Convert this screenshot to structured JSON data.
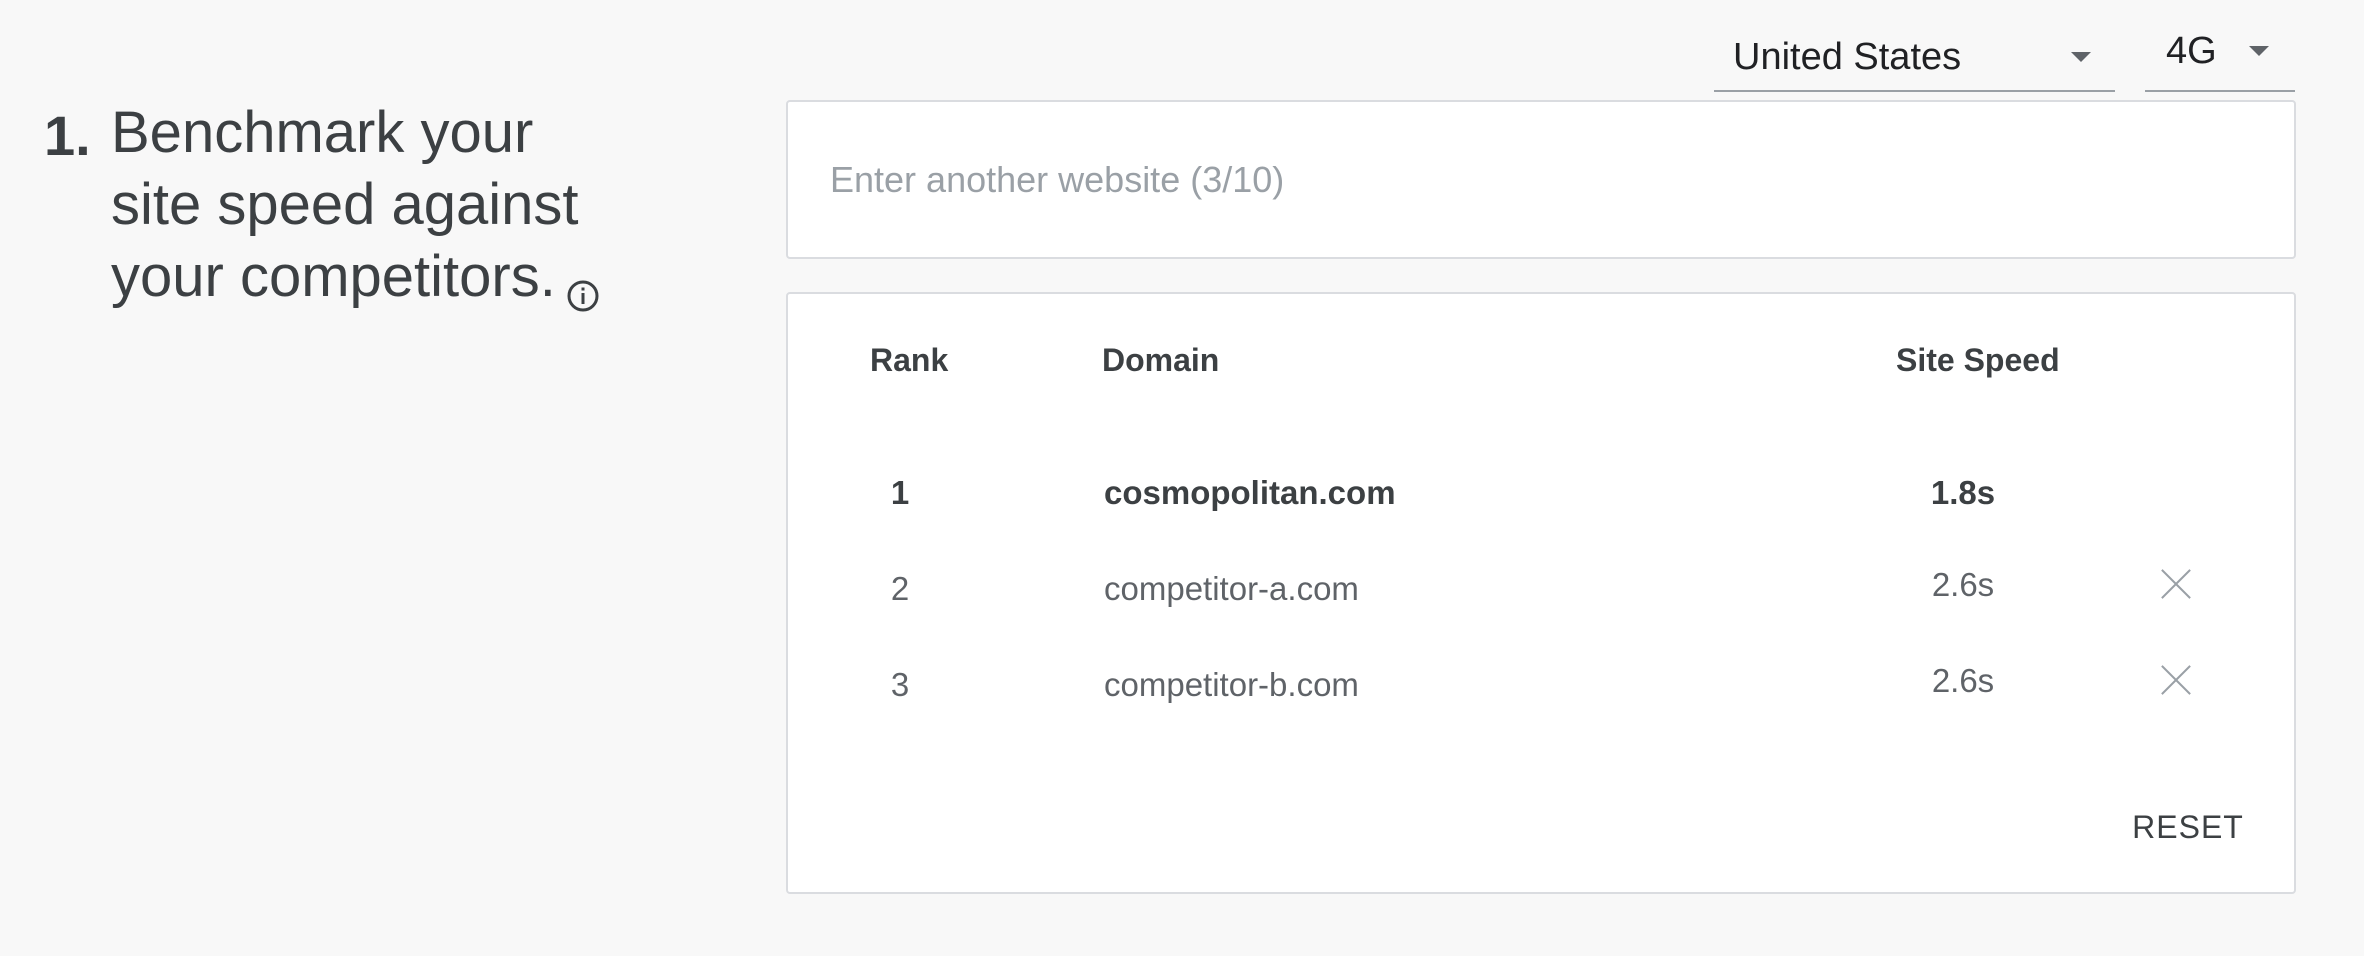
{
  "heading": {
    "number": "1.",
    "lines": [
      "Benchmark your",
      "site speed against",
      "your competitors."
    ],
    "info_icon": "info-circle-icon"
  },
  "filters": {
    "country": "United States",
    "network": "4G"
  },
  "search": {
    "placeholder": "Enter another website (3/10)",
    "value": ""
  },
  "table": {
    "headers": {
      "rank": "Rank",
      "domain": "Domain",
      "speed": "Site Speed"
    },
    "rows": [
      {
        "rank": "1",
        "domain": "cosmopolitan.com",
        "speed": "1.8s"
      },
      {
        "rank": "2",
        "domain": "competitor-a.com",
        "speed": "2.6s"
      },
      {
        "rank": "3",
        "domain": "competitor-b.com",
        "speed": "2.6s"
      }
    ],
    "remove_icon": "close-icon",
    "reset_label": "RESET"
  },
  "colors": {
    "background": "#f8f8f8",
    "card": "#ffffff",
    "border": "#dadce0",
    "text_primary": "#3c4043",
    "text_secondary": "#5f6368"
  }
}
